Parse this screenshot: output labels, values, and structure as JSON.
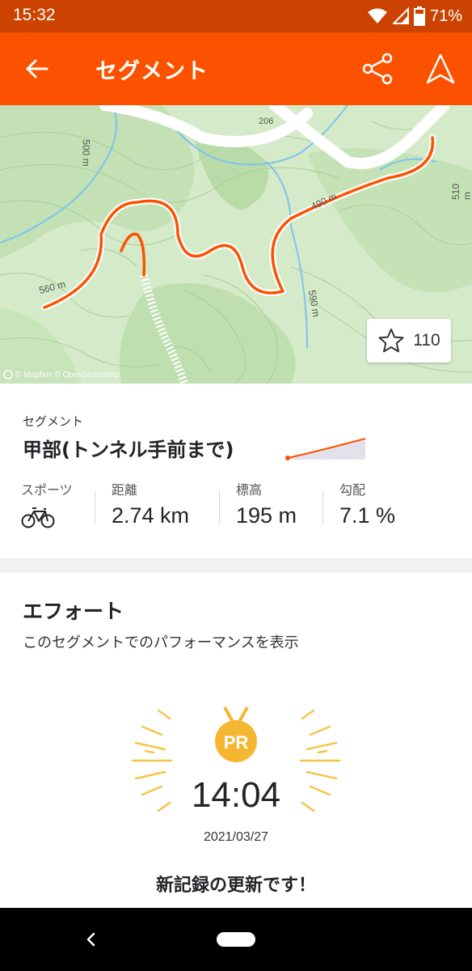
{
  "status_bar": {
    "time": "15:32",
    "battery": "71%"
  },
  "header": {
    "title": "セグメント"
  },
  "map": {
    "contour_labels": [
      "206",
      "500 m",
      "490 m",
      "510 m",
      "560 m",
      "590 m"
    ],
    "star_count": "110",
    "attribution": "© Mapbox © OpenStreetMap"
  },
  "segment": {
    "label": "セグメント",
    "name": "甲部(トンネル手前まで)",
    "stats": [
      {
        "label": "スポーツ",
        "value": ""
      },
      {
        "label": "距離",
        "value": "2.74 km"
      },
      {
        "label": "標高",
        "value": "195 m"
      },
      {
        "label": "勾配",
        "value": "7.1 %"
      }
    ]
  },
  "efforts": {
    "title": "エフォート",
    "description": "このセグメントでのパフォーマンスを表示",
    "pr_badge": "PR",
    "pr_time": "14:04",
    "pr_date": "2021/03/27",
    "pr_message": "新記録の更新です！"
  },
  "colors": {
    "brand": "#fc5200",
    "status_bar": "#cc4200",
    "route": "#fc5200",
    "medal": "#f5b731"
  },
  "icons": [
    "wifi-icon",
    "signal-icon",
    "battery-icon",
    "back-arrow-icon",
    "share-icon",
    "navigation-icon",
    "star-icon",
    "bicycle-icon",
    "pr-medal-icon"
  ]
}
